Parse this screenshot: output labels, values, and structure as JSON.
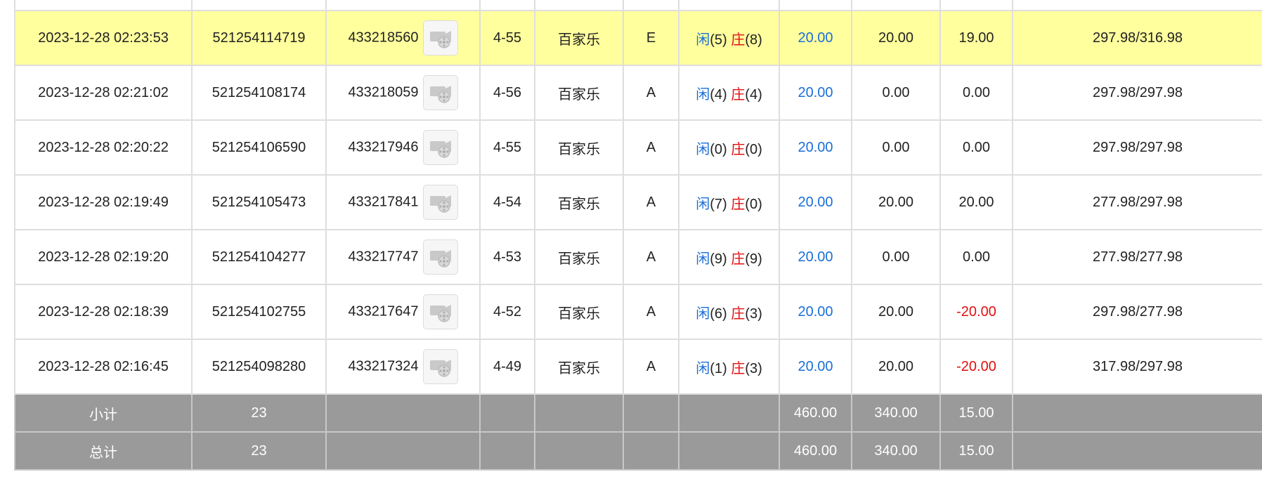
{
  "colors": {
    "row_highlight": "#ffff9e",
    "summary_bg": "#9a9a9a",
    "blue": "#1a6fd8",
    "red": "#e01010"
  },
  "video_icon": "video-replay-icon",
  "rows": [
    {
      "time": "2023-12-28 02:23:53",
      "order": "521254114719",
      "round": "433218560",
      "shoe": "4-55",
      "game": "百家乐",
      "table": "E",
      "player_label": "闲",
      "player_score": "(5)",
      "banker_label": "庄",
      "banker_score": "(8)",
      "bet": "20.00",
      "valid": "20.00",
      "payout": "19.00",
      "payout_negative": false,
      "balance": "297.98/316.98",
      "highlight": true
    },
    {
      "time": "2023-12-28 02:21:02",
      "order": "521254108174",
      "round": "433218059",
      "shoe": "4-56",
      "game": "百家乐",
      "table": "A",
      "player_label": "闲",
      "player_score": "(4)",
      "banker_label": "庄",
      "banker_score": "(4)",
      "bet": "20.00",
      "valid": "0.00",
      "payout": "0.00",
      "payout_negative": false,
      "balance": "297.98/297.98",
      "highlight": false
    },
    {
      "time": "2023-12-28 02:20:22",
      "order": "521254106590",
      "round": "433217946",
      "shoe": "4-55",
      "game": "百家乐",
      "table": "A",
      "player_label": "闲",
      "player_score": "(0)",
      "banker_label": "庄",
      "banker_score": "(0)",
      "bet": "20.00",
      "valid": "0.00",
      "payout": "0.00",
      "payout_negative": false,
      "balance": "297.98/297.98",
      "highlight": false
    },
    {
      "time": "2023-12-28 02:19:49",
      "order": "521254105473",
      "round": "433217841",
      "shoe": "4-54",
      "game": "百家乐",
      "table": "A",
      "player_label": "闲",
      "player_score": "(7)",
      "banker_label": "庄",
      "banker_score": "(0)",
      "bet": "20.00",
      "valid": "20.00",
      "payout": "20.00",
      "payout_negative": false,
      "balance": "277.98/297.98",
      "highlight": false
    },
    {
      "time": "2023-12-28 02:19:20",
      "order": "521254104277",
      "round": "433217747",
      "shoe": "4-53",
      "game": "百家乐",
      "table": "A",
      "player_label": "闲",
      "player_score": "(9)",
      "banker_label": "庄",
      "banker_score": "(9)",
      "bet": "20.00",
      "valid": "0.00",
      "payout": "0.00",
      "payout_negative": false,
      "balance": "277.98/277.98",
      "highlight": false
    },
    {
      "time": "2023-12-28 02:18:39",
      "order": "521254102755",
      "round": "433217647",
      "shoe": "4-52",
      "game": "百家乐",
      "table": "A",
      "player_label": "闲",
      "player_score": "(6)",
      "banker_label": "庄",
      "banker_score": "(3)",
      "bet": "20.00",
      "valid": "20.00",
      "payout": "-20.00",
      "payout_negative": true,
      "balance": "297.98/277.98",
      "highlight": false
    },
    {
      "time": "2023-12-28 02:16:45",
      "order": "521254098280",
      "round": "433217324",
      "shoe": "4-49",
      "game": "百家乐",
      "table": "A",
      "player_label": "闲",
      "player_score": "(1)",
      "banker_label": "庄",
      "banker_score": "(3)",
      "bet": "20.00",
      "valid": "20.00",
      "payout": "-20.00",
      "payout_negative": true,
      "balance": "317.98/297.98",
      "highlight": false
    }
  ],
  "subtotal": {
    "label": "小计",
    "count": "23",
    "bet": "460.00",
    "valid": "340.00",
    "payout": "15.00"
  },
  "total": {
    "label": "总计",
    "count": "23",
    "bet": "460.00",
    "valid": "340.00",
    "payout": "15.00"
  }
}
